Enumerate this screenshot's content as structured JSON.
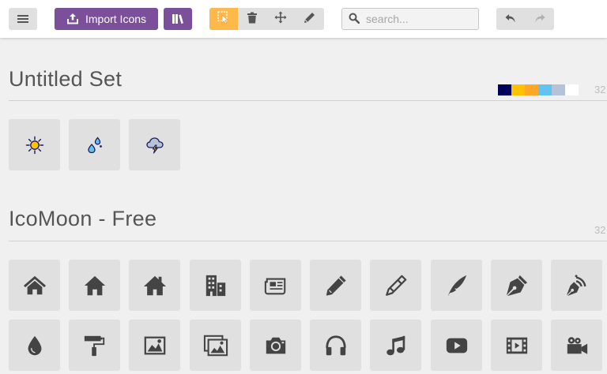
{
  "toolbar": {
    "import_label": "Import Icons",
    "search_placeholder": "search..."
  },
  "sets": [
    {
      "title": "Untitled Set",
      "size": "32",
      "palette": [
        "#00005c",
        "#ffc200",
        "#ffa726",
        "#62c3f0",
        "#b4c4d6",
        "#ffffff"
      ],
      "icons": [
        "sun-icon",
        "raindrops-icon",
        "thunderstorm-cloud-icon"
      ]
    },
    {
      "title": "IcoMoon - Free",
      "size": "32",
      "icons": [
        "home-icon",
        "home2-icon",
        "home3-icon",
        "office-icon",
        "newspaper-icon",
        "pencil-icon",
        "pencil2-icon",
        "quill-icon",
        "pen-icon",
        "blog-icon",
        "eyedropper-icon",
        "paint-roller-icon",
        "image-icon",
        "images-icon",
        "camera-icon",
        "headphones-icon",
        "music-icon",
        "play-icon",
        "film-icon",
        "video-camera-icon"
      ]
    }
  ]
}
